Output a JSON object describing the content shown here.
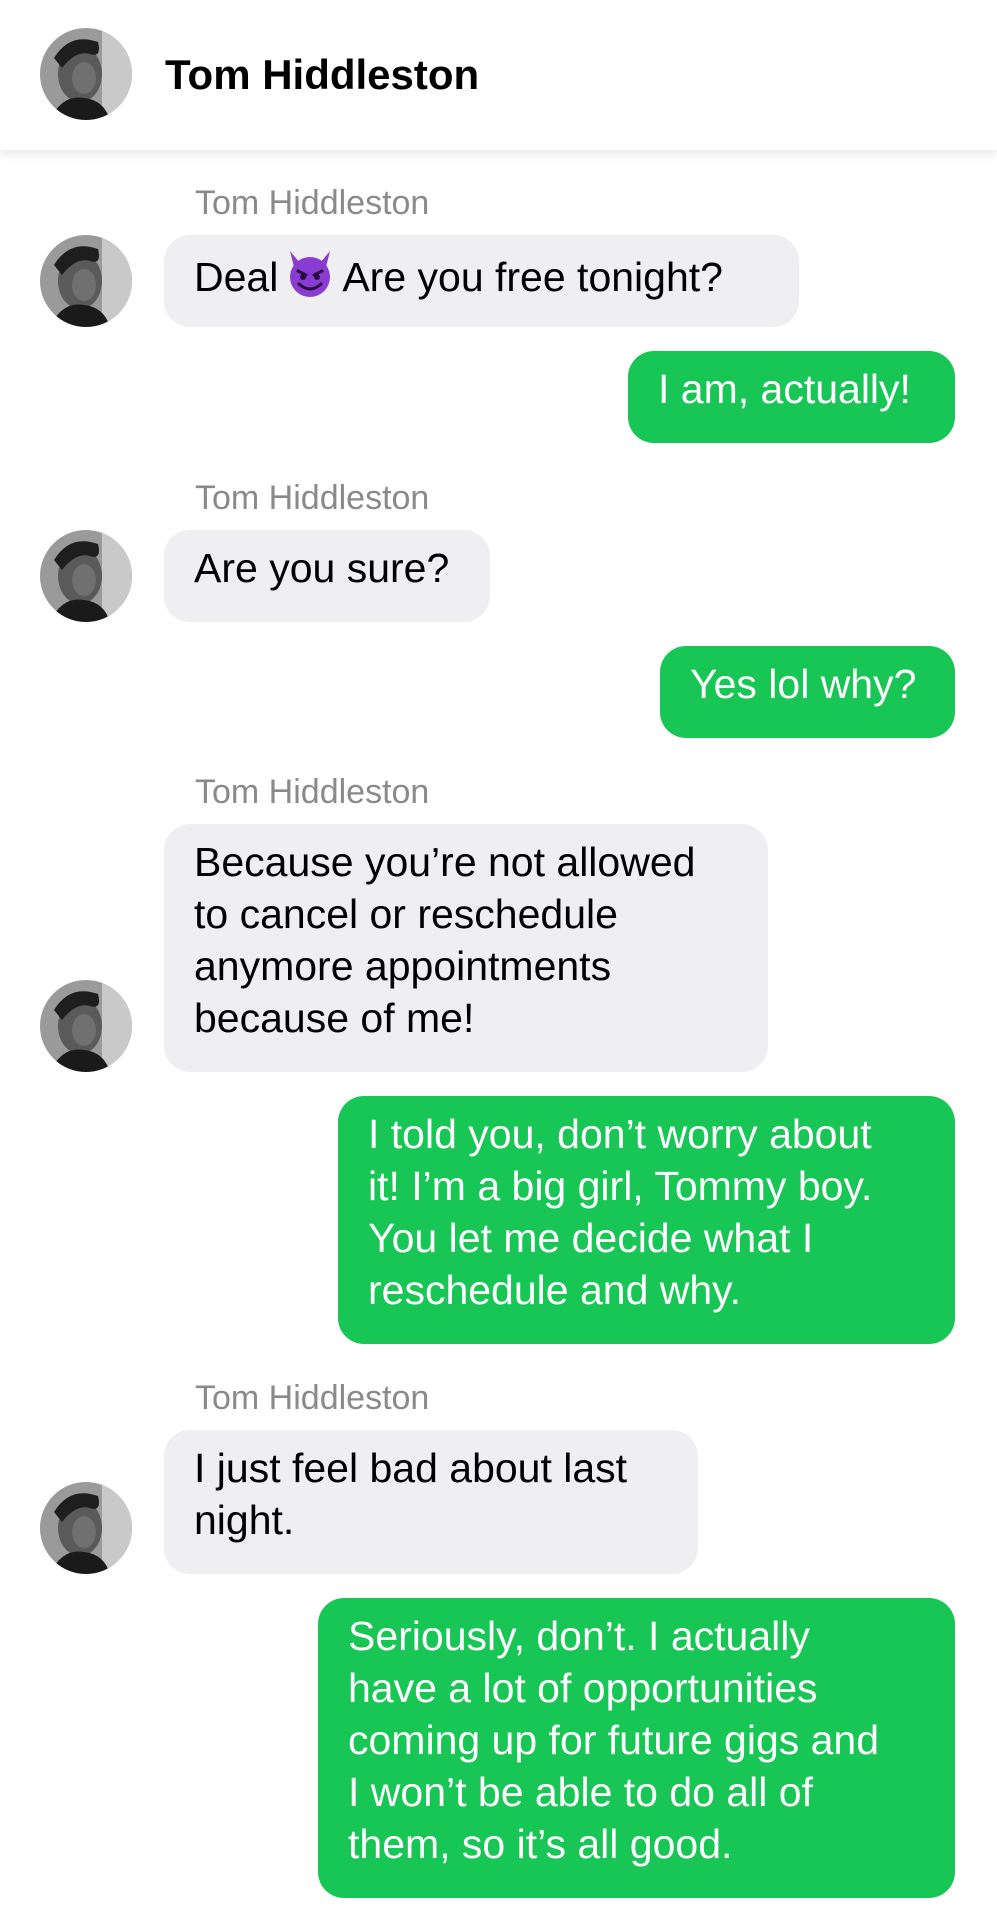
{
  "header": {
    "contact_name": "Tom Hiddleston",
    "avatar_icon": "contact-photo-icon"
  },
  "colors": {
    "incoming_bubble": "#efeff2",
    "outgoing_bubble": "#18c655",
    "sender_label": "#8a8a8e"
  },
  "messages": [
    {
      "direction": "incoming",
      "sender": "Tom Hiddleston",
      "parts": [
        "Deal",
        "Are you free tonight?"
      ],
      "emoji_icon": "smiling-devil-emoji-icon"
    },
    {
      "direction": "outgoing",
      "lines": [
        "I am, actually!"
      ]
    },
    {
      "direction": "incoming",
      "sender": "Tom Hiddleston",
      "lines": [
        "Are you sure?"
      ]
    },
    {
      "direction": "outgoing",
      "lines": [
        "Yes lol why?"
      ]
    },
    {
      "direction": "incoming",
      "sender": "Tom Hiddleston",
      "lines": [
        "Because you’re not allowed",
        "to cancel or reschedule",
        "anymore appointments",
        "because of me!"
      ]
    },
    {
      "direction": "outgoing",
      "lines": [
        "I told you, don’t worry about",
        "it! I’m a big girl, Tommy boy.",
        "You let me decide what I",
        "reschedule and why."
      ]
    },
    {
      "direction": "incoming",
      "sender": "Tom Hiddleston",
      "lines": [
        "I just feel bad about last",
        "night."
      ]
    },
    {
      "direction": "outgoing",
      "lines": [
        "Seriously, don’t. I actually",
        "have a lot of opportunities",
        "coming up for future gigs and",
        "I won’t be able to do all of",
        "them, so it’s all good."
      ]
    }
  ]
}
